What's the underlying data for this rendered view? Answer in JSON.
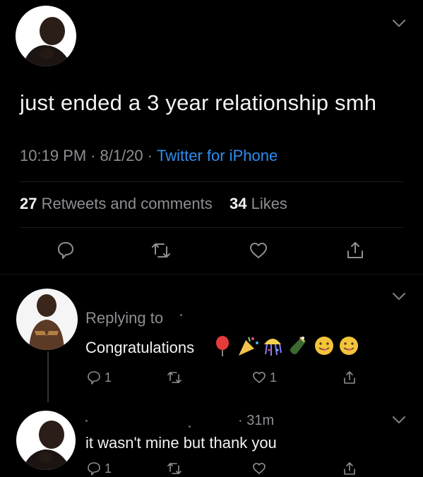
{
  "main_tweet": {
    "text": "just ended a 3 year relationship smh",
    "time": "10:19 PM",
    "dot": "·",
    "date": "8/1/20",
    "source": "Twitter for iPhone",
    "retweets_count": "27",
    "retweets_label": "Retweets and comments",
    "likes_count": "34",
    "likes_label": "Likes"
  },
  "reply": {
    "replying_to": "Replying to",
    "text": "Congratulations",
    "reply_count": "1",
    "like_count": "1"
  },
  "reply2": {
    "time": "· 31m",
    "text": "it wasn't mine but thank you",
    "reply_count": "1"
  },
  "colors": {
    "background": "#000000",
    "link": "#2f8df0",
    "muted": "#8e8e93"
  },
  "icons": {
    "reply": "reply-icon",
    "retweet": "retweet-icon",
    "like": "heart-icon",
    "share": "share-icon",
    "more": "chevron-down-icon"
  }
}
